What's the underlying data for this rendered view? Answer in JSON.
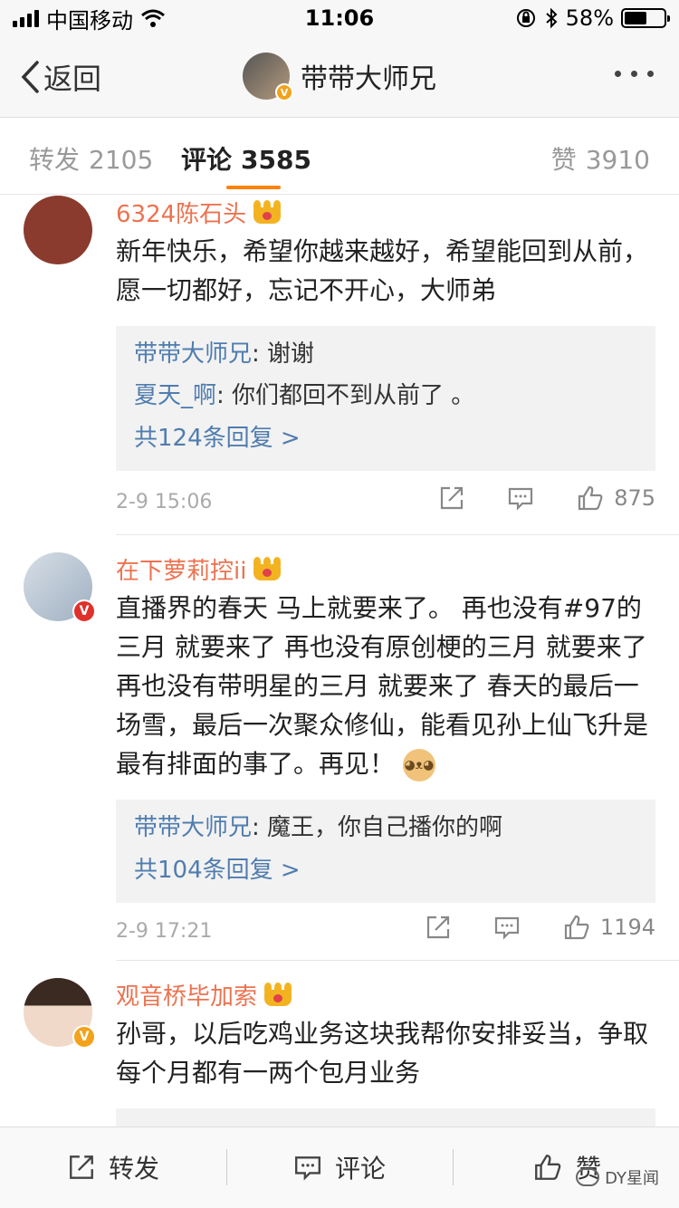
{
  "status_bar": {
    "carrier": "中国移动",
    "time": "11:06",
    "battery_percent": "58%",
    "battery_level": 0.58
  },
  "nav": {
    "back_label": "返回",
    "title": "带带大师兄",
    "verified_badge": "V"
  },
  "tabs": [
    {
      "label": "转发",
      "count": "2105"
    },
    {
      "label": "评论",
      "count": "3585"
    },
    {
      "label": "赞",
      "count": "3910"
    }
  ],
  "comments": [
    {
      "user": "6324陈石头",
      "verified": false,
      "text": "新年快乐，希望你越来越好，希望能回到从前，愿一切都好，忘记不开心，大师弟",
      "replies": [
        {
          "name": "带带大师兄",
          "text": ": 谢谢"
        },
        {
          "name": "夏天_啊",
          "text": ": 你们都回不到从前了 。"
        }
      ],
      "more_replies": "共124条回复 >",
      "time": "2-9 15:06",
      "likes": "875",
      "avatar_color": "#8a3b2e"
    },
    {
      "user": "在下萝莉控ii",
      "verified": true,
      "text": "直播界的春天 马上就要来了。 再也没有#97的三月 就要来了  再也没有原创梗的三月 就要来了 再也没有带明星的三月 就要来了 春天的最后一场雪，最后一次聚众修仙，能看见孙上仙飞升是最有排面的事了。再见！",
      "emoji": "doge",
      "replies": [
        {
          "name": "带带大师兄",
          "text": ": 魔王，你自己播你的啊"
        }
      ],
      "more_replies": "共104条回复 >",
      "time": "2-9 17:21",
      "likes": "1194",
      "avatar_color": "#c9d4de"
    },
    {
      "user": "观音桥毕加索",
      "verified": true,
      "text": "孙哥，以后吃鸡业务这块我帮你安排妥当，争取每个月都有一两个包月业务",
      "time": "",
      "likes": "",
      "avatar_color": "#e8ddd4"
    }
  ],
  "bottom_bar": {
    "repost_label": "转发",
    "comment_label": "评论",
    "like_label": "赞"
  },
  "watermark": "DY星闻",
  "colors": {
    "username": "#eb7350",
    "link": "#507daf",
    "accent": "#ff8200",
    "verified": "#f3a21b"
  }
}
